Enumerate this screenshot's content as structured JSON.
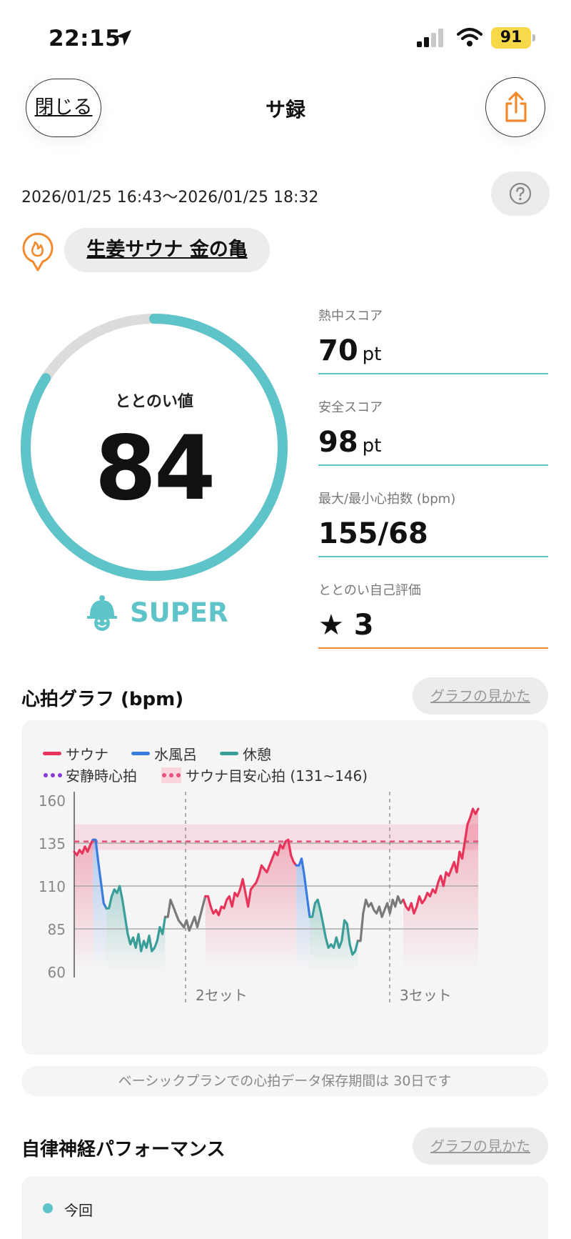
{
  "status_bar": {
    "time": "22:15",
    "battery": "91"
  },
  "header": {
    "close_label": "閉じる",
    "title": "サ録"
  },
  "session": {
    "date_range": "2026/01/25 16:43〜2026/01/25 18:32",
    "place": "生姜サウナ 金の亀"
  },
  "gauge": {
    "label": "ととのい値",
    "value": "84",
    "fill_fraction": 0.84,
    "rank": "SUPER"
  },
  "scores": [
    {
      "label": "熱中スコア",
      "value": "70",
      "unit": "pt"
    },
    {
      "label": "安全スコア",
      "value": "98",
      "unit": "pt"
    },
    {
      "label": "最大/最小心拍数 (bpm)",
      "value": "155/68",
      "unit": ""
    },
    {
      "label": "ととのい自己評価",
      "value": "★ 3",
      "unit": ""
    }
  ],
  "heart_section": {
    "title": "心拍グラフ (bpm)",
    "howto_label": "グラフの見かた"
  },
  "legend": {
    "sauna": "サウナ",
    "water": "水風呂",
    "rest": "休憩",
    "resting_hr": "安静時心拍",
    "target_hr": "サウナ目安心拍 (131~146)"
  },
  "colors": {
    "sauna": "#e8345a",
    "water": "#3a7be0",
    "rest": "#3a9e98",
    "idle": "#7a7a7a",
    "resting_hr": "#8a3ad8",
    "target_hr": "#e8507a",
    "accent": "#5ec4c9"
  },
  "chart_data": {
    "type": "line",
    "y_ticks": [
      "160",
      "135",
      "110",
      "85",
      "60"
    ],
    "ylim": [
      60,
      160
    ],
    "resting_hr": 85,
    "target_band": [
      131,
      146
    ],
    "set_labels": [
      "2セット",
      "3セット"
    ],
    "segments": [
      {
        "phase": "sauna",
        "values": [
          130,
          128,
          131,
          129,
          133,
          130,
          134,
          137
        ]
      },
      {
        "phase": "water",
        "values": [
          137,
          124,
          112,
          100,
          97
        ]
      },
      {
        "phase": "rest",
        "values": [
          97,
          104,
          108,
          106,
          110,
          102,
          92,
          82,
          76,
          80,
          74,
          82,
          72,
          78,
          74,
          81,
          72,
          74,
          78,
          86,
          82,
          92
        ]
      },
      {
        "phase": "idle",
        "values": [
          92,
          102,
          98,
          94,
          90,
          88,
          86,
          90,
          84,
          88,
          92,
          86,
          92,
          98,
          104
        ]
      },
      {
        "phase": "sauna",
        "values": [
          104,
          98,
          94,
          96,
          93,
          98,
          97,
          102,
          104,
          98,
          106,
          104,
          108,
          114,
          106,
          98,
          108,
          110,
          112,
          116,
          122,
          120,
          118,
          122,
          126,
          130,
          128,
          134,
          132,
          136,
          137,
          128,
          124,
          122
        ]
      },
      {
        "phase": "water",
        "values": [
          122,
          126,
          116,
          104,
          92
        ]
      },
      {
        "phase": "rest",
        "values": [
          92,
          100,
          102,
          96,
          88,
          80,
          74,
          76,
          74,
          80,
          74,
          78,
          90,
          88,
          76,
          70,
          72,
          78
        ]
      },
      {
        "phase": "idle",
        "values": [
          78,
          94,
          102,
          98,
          100,
          96,
          94,
          98,
          92,
          96,
          100,
          94,
          102,
          98,
          104,
          100,
          102
        ]
      },
      {
        "phase": "sauna",
        "values": [
          98,
          96,
          100,
          94,
          98,
          104,
          100,
          102,
          106,
          104,
          108,
          106,
          112,
          116,
          110,
          118,
          116,
          120,
          124,
          118,
          130,
          126,
          136,
          146,
          150,
          155,
          152,
          155
        ]
      }
    ]
  },
  "notice": "ベーシックプランでの心拍データ保存期間は 30日です",
  "anp_section": {
    "title": "自律神経パフォーマンス",
    "howto_label": "グラフの見かた",
    "series_label": "今回"
  }
}
